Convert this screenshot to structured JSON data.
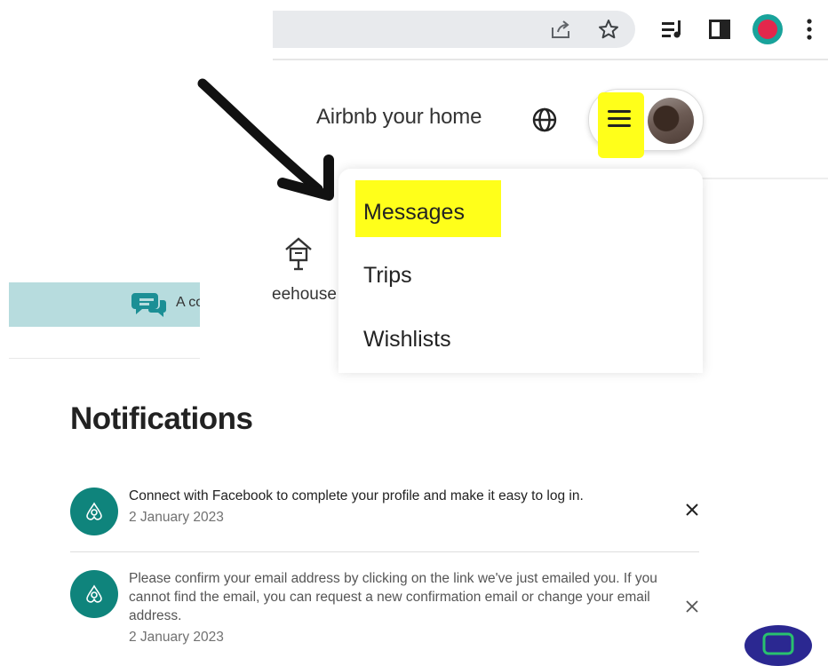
{
  "browser": {
    "icons": [
      "share-icon",
      "bookmark-star-icon",
      "media-control-icon",
      "side-panel-icon",
      "profile-icon",
      "more-menu-icon"
    ]
  },
  "header": {
    "host_link": "Airbnb your home",
    "globe_icon": "globe-icon",
    "menu_icon": "hamburger-menu-icon",
    "highlight_color": "#ffff1a"
  },
  "dropdown": {
    "items": [
      {
        "label": "Messages",
        "highlighted": true
      },
      {
        "label": "Trips"
      },
      {
        "label": "Wishlists"
      }
    ]
  },
  "category": {
    "label": "eehouse",
    "icon": "treehouse-icon"
  },
  "banner": {
    "text": "A co",
    "icon": "chat-bubbles-icon",
    "color": "#b7dcde"
  },
  "notifications": {
    "title": "Notifications",
    "items": [
      {
        "text": "Connect with Facebook to complete your profile and make it easy to log in.",
        "date": "2 January 2023"
      },
      {
        "text": "Please confirm your email address by clicking on the link we've just emailed you. If you cannot find the email, you can request a new confirmation email or change your email address.",
        "date": "2 January 2023"
      }
    ],
    "avatar_color": "#0f847c"
  }
}
